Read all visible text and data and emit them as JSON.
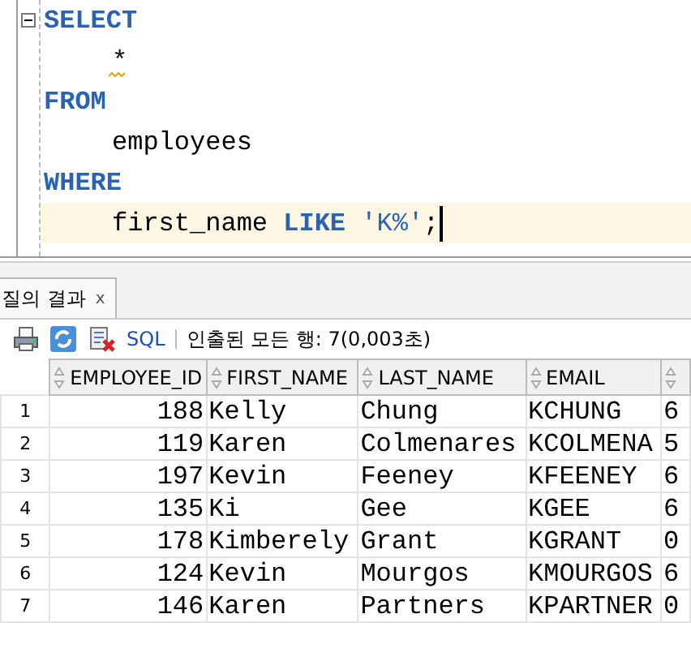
{
  "editor": {
    "lines": [
      {
        "indented": false,
        "current": false,
        "warning": false,
        "tokens": [
          {
            "text": "SELECT",
            "kind": "keyword"
          }
        ]
      },
      {
        "indented": true,
        "current": false,
        "warning": true,
        "tokens": [
          {
            "text": "*",
            "kind": "plain"
          }
        ]
      },
      {
        "indented": false,
        "current": false,
        "warning": false,
        "tokens": [
          {
            "text": "FROM",
            "kind": "keyword"
          }
        ]
      },
      {
        "indented": true,
        "current": false,
        "warning": false,
        "tokens": [
          {
            "text": "employees",
            "kind": "plain"
          }
        ]
      },
      {
        "indented": false,
        "current": false,
        "warning": false,
        "tokens": [
          {
            "text": "WHERE",
            "kind": "keyword"
          }
        ]
      },
      {
        "indented": true,
        "current": true,
        "warning": false,
        "tokens": [
          {
            "text": "first_name ",
            "kind": "plain"
          },
          {
            "text": "LIKE ",
            "kind": "keyword"
          },
          {
            "text": "'K%'",
            "kind": "string"
          },
          {
            "text": ";",
            "kind": "plain"
          }
        ]
      }
    ]
  },
  "results_tab": {
    "label": "질의 결과",
    "close": "x"
  },
  "toolbar": {
    "sql_link": "SQL",
    "status": "인출된 모든 행: 7(0,003초)"
  },
  "table": {
    "columns": [
      "",
      "EMPLOYEE_ID",
      "FIRST_NAME",
      "LAST_NAME",
      "EMAIL",
      ""
    ],
    "rows": [
      [
        "1",
        "188",
        "Kelly",
        "Chung",
        "KCHUNG",
        "6"
      ],
      [
        "2",
        "119",
        "Karen",
        "Colmenares",
        "KCOLMENA",
        "5"
      ],
      [
        "3",
        "197",
        "Kevin",
        "Feeney",
        "KFEENEY",
        "6"
      ],
      [
        "4",
        "135",
        "Ki",
        "Gee",
        "KGEE",
        "6"
      ],
      [
        "5",
        "178",
        "Kimberely",
        "Grant",
        "KGRANT",
        "0"
      ],
      [
        "6",
        "124",
        "Kevin",
        "Mourgos",
        "KMOURGOS",
        "6"
      ],
      [
        "7",
        "146",
        "Karen",
        "Partners",
        "KPARTNER",
        "0"
      ]
    ]
  }
}
